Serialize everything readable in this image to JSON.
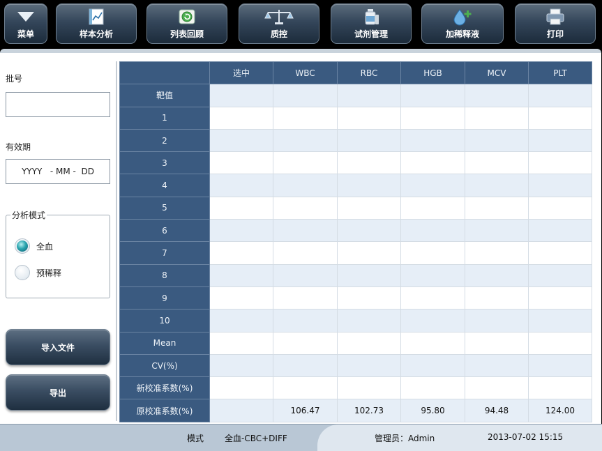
{
  "toolbar": {
    "buttons": [
      {
        "label": "菜单",
        "icon": "triangle-down-icon"
      },
      {
        "label": "样本分析",
        "icon": "chart-doc-icon"
      },
      {
        "label": "列表回顾",
        "icon": "clock-refresh-icon"
      },
      {
        "label": "质控",
        "icon": "balance-scale-icon"
      },
      {
        "label": "试剂管理",
        "icon": "reagent-bottle-icon"
      },
      {
        "label": "加稀释液",
        "icon": "droplet-plus-icon"
      },
      {
        "label": "打印",
        "icon": "printer-icon"
      }
    ]
  },
  "sidebar": {
    "batch_label": "批号",
    "batch_value": "",
    "expiry_label": "有效期",
    "expiry_placeholder": "YYYY   - MM -  DD",
    "mode_group_title": "分析模式",
    "mode_options": [
      {
        "label": "全血",
        "selected": true
      },
      {
        "label": "预稀释",
        "selected": false
      }
    ],
    "import_button": "导入文件",
    "export_button": "导出"
  },
  "table": {
    "columns": [
      "选中",
      "WBC",
      "RBC",
      "HGB",
      "MCV",
      "PLT"
    ],
    "rows": [
      {
        "label": "靶值",
        "cells": [
          "",
          "",
          "",
          "",
          "",
          ""
        ]
      },
      {
        "label": "1",
        "cells": [
          "",
          "",
          "",
          "",
          "",
          ""
        ]
      },
      {
        "label": "2",
        "cells": [
          "",
          "",
          "",
          "",
          "",
          ""
        ]
      },
      {
        "label": "3",
        "cells": [
          "",
          "",
          "",
          "",
          "",
          ""
        ]
      },
      {
        "label": "4",
        "cells": [
          "",
          "",
          "",
          "",
          "",
          ""
        ]
      },
      {
        "label": "5",
        "cells": [
          "",
          "",
          "",
          "",
          "",
          ""
        ]
      },
      {
        "label": "6",
        "cells": [
          "",
          "",
          "",
          "",
          "",
          ""
        ]
      },
      {
        "label": "7",
        "cells": [
          "",
          "",
          "",
          "",
          "",
          ""
        ]
      },
      {
        "label": "8",
        "cells": [
          "",
          "",
          "",
          "",
          "",
          ""
        ]
      },
      {
        "label": "9",
        "cells": [
          "",
          "",
          "",
          "",
          "",
          ""
        ]
      },
      {
        "label": "10",
        "cells": [
          "",
          "",
          "",
          "",
          "",
          ""
        ]
      },
      {
        "label": "Mean",
        "cells": [
          "",
          "",
          "",
          "",
          "",
          ""
        ]
      },
      {
        "label": "CV(%)",
        "cells": [
          "",
          "",
          "",
          "",
          "",
          ""
        ]
      },
      {
        "label": "新校准系数(%)",
        "cells": [
          "",
          "",
          "",
          "",
          "",
          ""
        ]
      },
      {
        "label": "原校准系数(%)",
        "cells": [
          "",
          "106.47",
          "102.73",
          "95.80",
          "94.48",
          "124.00"
        ]
      }
    ]
  },
  "status_bar": {
    "mode_label": "模式",
    "mode_value": "全血-CBC+DIFF",
    "user": "管理员：Admin",
    "datetime": "2013-07-02 15:15"
  },
  "colors": {
    "header_blue": "#3a5a80",
    "row_alt": "#e6eef7",
    "radio_selected": "#2aa4ae"
  }
}
